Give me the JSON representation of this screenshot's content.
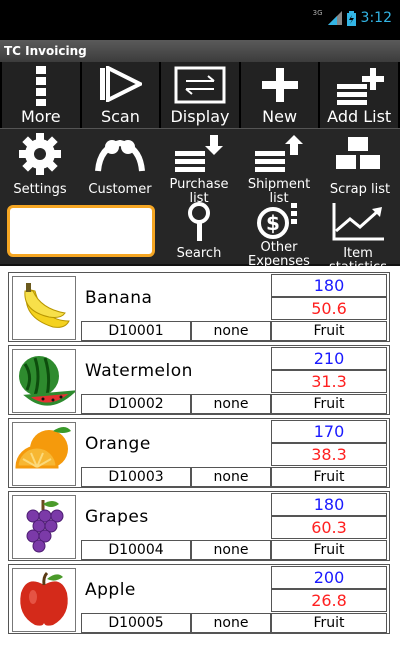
{
  "status": {
    "signal": "3G",
    "time": "3:12"
  },
  "app": {
    "title": "TC Invoicing"
  },
  "toolbar": {
    "more": "More",
    "scan": "Scan",
    "display": "Display",
    "new": "New",
    "add_list": "Add List"
  },
  "panel": {
    "settings": "Settings",
    "customer": "Customer",
    "purchase_list": "Purchase list",
    "shipment_list": "Shipment list",
    "scrap_list": "Scrap list",
    "search": "Search",
    "other_expenses": "Other Expenses",
    "item_statistics": "Item statistics",
    "search_value": ""
  },
  "items": [
    {
      "name": "Banana",
      "qty": "180",
      "price": "50.6",
      "code": "D10001",
      "note": "none",
      "category": "Fruit",
      "icon": "banana-icon"
    },
    {
      "name": "Watermelon",
      "qty": "210",
      "price": "31.3",
      "code": "D10002",
      "note": "none",
      "category": "Fruit",
      "icon": "watermelon-icon"
    },
    {
      "name": "Orange",
      "qty": "170",
      "price": "38.3",
      "code": "D10003",
      "note": "none",
      "category": "Fruit",
      "icon": "orange-icon"
    },
    {
      "name": "Grapes",
      "qty": "180",
      "price": "60.3",
      "code": "D10004",
      "note": "none",
      "category": "Fruit",
      "icon": "grapes-icon"
    },
    {
      "name": "Apple",
      "qty": "200",
      "price": "26.8",
      "code": "D10005",
      "note": "none",
      "category": "Fruit",
      "icon": "apple-icon"
    }
  ]
}
